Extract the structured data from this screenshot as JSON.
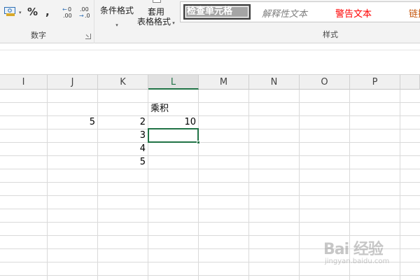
{
  "ribbon": {
    "number_group": {
      "percent_label": "%",
      "comma_label": ",",
      "increase_decimal": "←0\n.00",
      "decrease_decimal": ".00\n→.0",
      "group_label": "数字"
    },
    "conditional_format_label": "条件格式",
    "table_format_label_1": "套用",
    "table_format_label_2": "表格格式",
    "styles": {
      "check_cell": "检查单元格",
      "explanatory": "解释性文本",
      "warning": "警告文本",
      "link": "链接",
      "group_label": "样式"
    },
    "colors": {
      "check_bg": "#a5a5a5",
      "warning": "#ff0000",
      "explanatory": "#7f7f7f",
      "link": "#c65911"
    }
  },
  "sheet": {
    "columns": [
      "I",
      "J",
      "K",
      "L",
      "M",
      "N",
      "O",
      "P"
    ],
    "selected_column": "L",
    "accent_color": "#217346",
    "cells": {
      "L1": "乘积",
      "J2": "5",
      "K2": "2",
      "L2": "10",
      "K3": "3",
      "K4": "4",
      "K5": "5"
    },
    "active_cell": "L3"
  },
  "watermark": {
    "main": "Bai 经验",
    "sub": "jingyan.baidu.com"
  }
}
